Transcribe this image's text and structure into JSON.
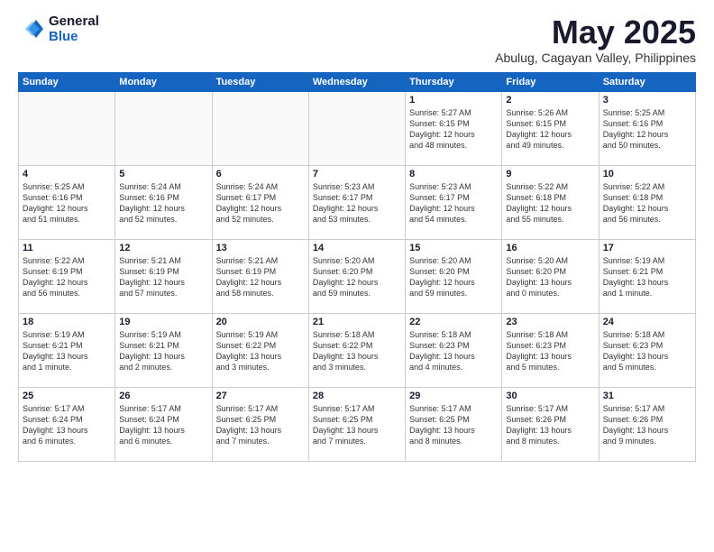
{
  "logo": {
    "general": "General",
    "blue": "Blue"
  },
  "title": {
    "month_year": "May 2025",
    "location": "Abulug, Cagayan Valley, Philippines"
  },
  "days_of_week": [
    "Sunday",
    "Monday",
    "Tuesday",
    "Wednesday",
    "Thursday",
    "Friday",
    "Saturday"
  ],
  "weeks": [
    [
      {
        "day": "",
        "text": ""
      },
      {
        "day": "",
        "text": ""
      },
      {
        "day": "",
        "text": ""
      },
      {
        "day": "",
        "text": ""
      },
      {
        "day": "1",
        "text": "Sunrise: 5:27 AM\nSunset: 6:15 PM\nDaylight: 12 hours\nand 48 minutes."
      },
      {
        "day": "2",
        "text": "Sunrise: 5:26 AM\nSunset: 6:15 PM\nDaylight: 12 hours\nand 49 minutes."
      },
      {
        "day": "3",
        "text": "Sunrise: 5:25 AM\nSunset: 6:16 PM\nDaylight: 12 hours\nand 50 minutes."
      }
    ],
    [
      {
        "day": "4",
        "text": "Sunrise: 5:25 AM\nSunset: 6:16 PM\nDaylight: 12 hours\nand 51 minutes."
      },
      {
        "day": "5",
        "text": "Sunrise: 5:24 AM\nSunset: 6:16 PM\nDaylight: 12 hours\nand 52 minutes."
      },
      {
        "day": "6",
        "text": "Sunrise: 5:24 AM\nSunset: 6:17 PM\nDaylight: 12 hours\nand 52 minutes."
      },
      {
        "day": "7",
        "text": "Sunrise: 5:23 AM\nSunset: 6:17 PM\nDaylight: 12 hours\nand 53 minutes."
      },
      {
        "day": "8",
        "text": "Sunrise: 5:23 AM\nSunset: 6:17 PM\nDaylight: 12 hours\nand 54 minutes."
      },
      {
        "day": "9",
        "text": "Sunrise: 5:22 AM\nSunset: 6:18 PM\nDaylight: 12 hours\nand 55 minutes."
      },
      {
        "day": "10",
        "text": "Sunrise: 5:22 AM\nSunset: 6:18 PM\nDaylight: 12 hours\nand 56 minutes."
      }
    ],
    [
      {
        "day": "11",
        "text": "Sunrise: 5:22 AM\nSunset: 6:19 PM\nDaylight: 12 hours\nand 56 minutes."
      },
      {
        "day": "12",
        "text": "Sunrise: 5:21 AM\nSunset: 6:19 PM\nDaylight: 12 hours\nand 57 minutes."
      },
      {
        "day": "13",
        "text": "Sunrise: 5:21 AM\nSunset: 6:19 PM\nDaylight: 12 hours\nand 58 minutes."
      },
      {
        "day": "14",
        "text": "Sunrise: 5:20 AM\nSunset: 6:20 PM\nDaylight: 12 hours\nand 59 minutes."
      },
      {
        "day": "15",
        "text": "Sunrise: 5:20 AM\nSunset: 6:20 PM\nDaylight: 12 hours\nand 59 minutes."
      },
      {
        "day": "16",
        "text": "Sunrise: 5:20 AM\nSunset: 6:20 PM\nDaylight: 13 hours\nand 0 minutes."
      },
      {
        "day": "17",
        "text": "Sunrise: 5:19 AM\nSunset: 6:21 PM\nDaylight: 13 hours\nand 1 minute."
      }
    ],
    [
      {
        "day": "18",
        "text": "Sunrise: 5:19 AM\nSunset: 6:21 PM\nDaylight: 13 hours\nand 1 minute."
      },
      {
        "day": "19",
        "text": "Sunrise: 5:19 AM\nSunset: 6:21 PM\nDaylight: 13 hours\nand 2 minutes."
      },
      {
        "day": "20",
        "text": "Sunrise: 5:19 AM\nSunset: 6:22 PM\nDaylight: 13 hours\nand 3 minutes."
      },
      {
        "day": "21",
        "text": "Sunrise: 5:18 AM\nSunset: 6:22 PM\nDaylight: 13 hours\nand 3 minutes."
      },
      {
        "day": "22",
        "text": "Sunrise: 5:18 AM\nSunset: 6:23 PM\nDaylight: 13 hours\nand 4 minutes."
      },
      {
        "day": "23",
        "text": "Sunrise: 5:18 AM\nSunset: 6:23 PM\nDaylight: 13 hours\nand 5 minutes."
      },
      {
        "day": "24",
        "text": "Sunrise: 5:18 AM\nSunset: 6:23 PM\nDaylight: 13 hours\nand 5 minutes."
      }
    ],
    [
      {
        "day": "25",
        "text": "Sunrise: 5:17 AM\nSunset: 6:24 PM\nDaylight: 13 hours\nand 6 minutes."
      },
      {
        "day": "26",
        "text": "Sunrise: 5:17 AM\nSunset: 6:24 PM\nDaylight: 13 hours\nand 6 minutes."
      },
      {
        "day": "27",
        "text": "Sunrise: 5:17 AM\nSunset: 6:25 PM\nDaylight: 13 hours\nand 7 minutes."
      },
      {
        "day": "28",
        "text": "Sunrise: 5:17 AM\nSunset: 6:25 PM\nDaylight: 13 hours\nand 7 minutes."
      },
      {
        "day": "29",
        "text": "Sunrise: 5:17 AM\nSunset: 6:25 PM\nDaylight: 13 hours\nand 8 minutes."
      },
      {
        "day": "30",
        "text": "Sunrise: 5:17 AM\nSunset: 6:26 PM\nDaylight: 13 hours\nand 8 minutes."
      },
      {
        "day": "31",
        "text": "Sunrise: 5:17 AM\nSunset: 6:26 PM\nDaylight: 13 hours\nand 9 minutes."
      }
    ]
  ]
}
